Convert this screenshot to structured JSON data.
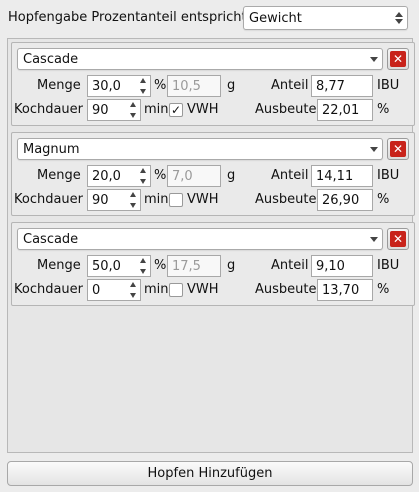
{
  "header": {
    "label": "Hopfengabe Prozentanteil entspricht",
    "mode_select": "Gewicht"
  },
  "labels": {
    "menge": "Menge",
    "kochdauer": "Kochdauer",
    "anteil": "Anteil",
    "ausbeute": "Ausbeute",
    "percent": "%",
    "g": "g",
    "min": "min",
    "vwh": "VWH",
    "ibu": "IBU",
    "delete": "✕"
  },
  "hops": [
    {
      "name": "Cascade",
      "menge": "30,0",
      "gramm": "10,5",
      "anteil": "8,77",
      "kochdauer": "90",
      "vwh_checked": true,
      "vwh_mark": "✓",
      "ausbeute": "22,01"
    },
    {
      "name": "Magnum",
      "menge": "20,0",
      "gramm": "7,0",
      "anteil": "14,11",
      "kochdauer": "90",
      "vwh_checked": false,
      "vwh_mark": "",
      "ausbeute": "26,90"
    },
    {
      "name": "Cascade",
      "menge": "50,0",
      "gramm": "17,5",
      "anteil": "9,10",
      "kochdauer": "0",
      "vwh_checked": false,
      "vwh_mark": "",
      "ausbeute": "13,70"
    }
  ],
  "footer": {
    "add_button": "Hopfen Hinzufügen"
  },
  "colors": {
    "delete_red": "#c8231b",
    "background": "#ececec"
  }
}
